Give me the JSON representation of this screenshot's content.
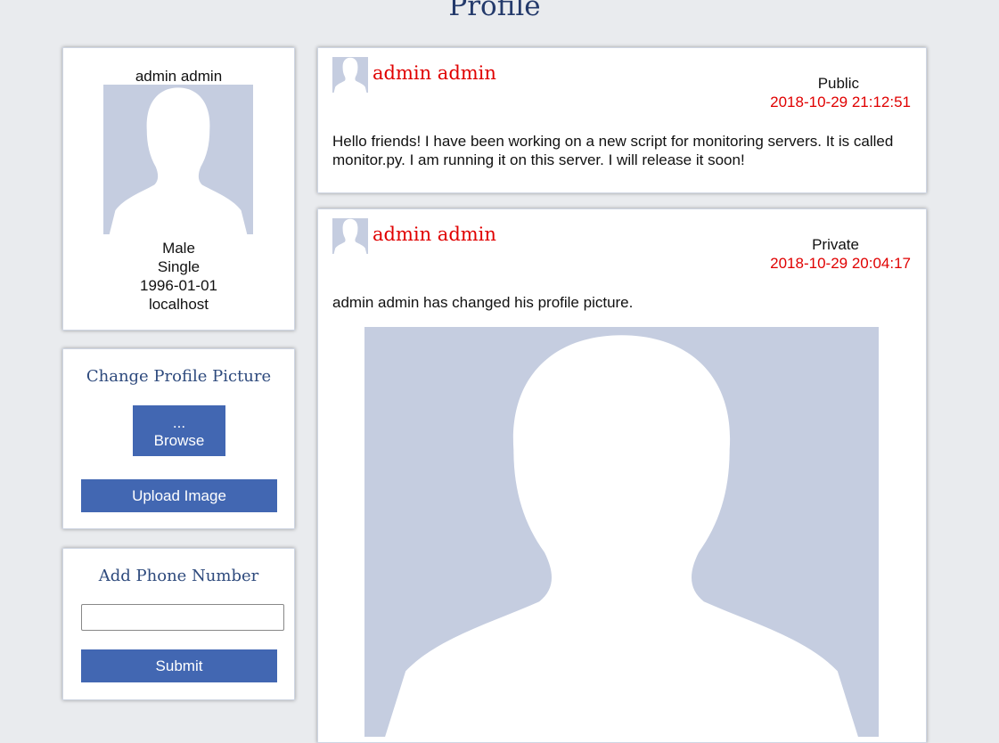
{
  "page": {
    "title": "Profile"
  },
  "profile": {
    "name": "admin admin",
    "gender": "Male",
    "status": "Single",
    "birthdate": "1996-01-01",
    "location": "localhost"
  },
  "upload": {
    "heading": "Change Profile Picture",
    "browse_dots": "...",
    "browse_label": "Browse",
    "upload_label": "Upload Image"
  },
  "phone": {
    "heading": "Add Phone Number",
    "value": "",
    "submit_label": "Submit"
  },
  "posts": [
    {
      "author": "admin admin",
      "visibility": "Public",
      "date": "2018-10-29 21:12:51",
      "text": "Hello friends! I have been working on a new script for monitoring servers. It is called monitor.py. I am running it on this server. I will release it soon!"
    },
    {
      "author": "admin admin",
      "visibility": "Private",
      "date": "2018-10-29 20:04:17",
      "text": "admin admin has changed his profile picture."
    }
  ],
  "colors": {
    "background": "#e9ebee",
    "accent": "#4267b2",
    "author_red": "#e00000",
    "avatar_bg": "#c5cde0",
    "heading_blue": "#2e4a7d"
  }
}
